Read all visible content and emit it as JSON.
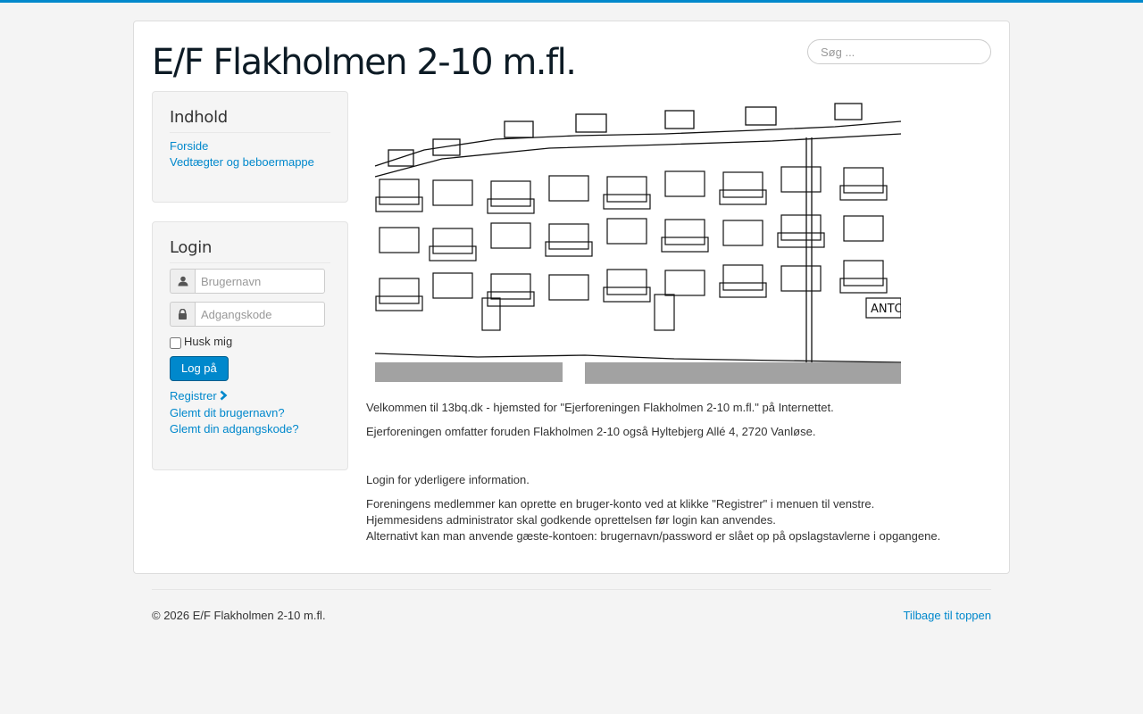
{
  "site": {
    "title": "E/F Flakholmen 2-10 m.fl."
  },
  "search": {
    "placeholder": "Søg ..."
  },
  "menu": {
    "heading": "Indhold",
    "items": [
      {
        "label": "Forside"
      },
      {
        "label": "Vedtægter og beboermappe"
      }
    ]
  },
  "login": {
    "heading": "Login",
    "username_placeholder": "Brugernavn",
    "password_placeholder": "Adgangskode",
    "remember_label": "Husk mig",
    "submit_label": "Log på",
    "register_label": "Registrer",
    "forgot_username_label": "Glemt dit brugernavn?",
    "forgot_password_label": "Glemt din adgangskode?",
    "user_icon": "user-icon",
    "lock_icon": "lock-icon"
  },
  "content": {
    "image_text": "ANTO",
    "paragraphs": [
      "Velkommen til 13bq.dk - hjemsted for \"Ejerforeningen Flakholmen 2-10 m.fl.\" på Internettet.",
      "Ejerforeningen omfatter foruden Flakholmen 2-10 også Hyltebjerg Allé 4, 2720 Vanløse.",
      "Login for yderligere information.",
      "Foreningens medlemmer kan oprette en bruger-konto ved at klikke \"Registrer\" i menuen til venstre.",
      "Hjemmesidens administrator skal godkende oprettelsen før login kan anvendes.",
      "Alternativt kan man anvende gæste-kontoen: brugernavn/password er slået op på opslagstavlerne i opgangene."
    ]
  },
  "footer": {
    "copyright": "© 2026 E/F Flakholmen 2-10 m.fl.",
    "back_to_top": "Tilbage til toppen"
  },
  "colors": {
    "accent": "#0088cc",
    "background": "#f4f4f4",
    "title": "#0d1b25"
  }
}
